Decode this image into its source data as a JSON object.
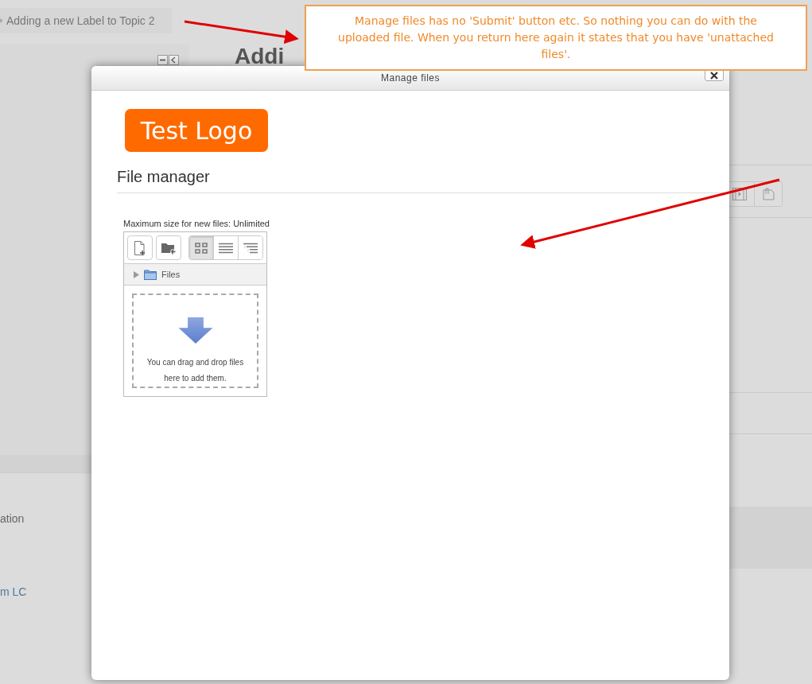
{
  "breadcrumb": "Adding a new Label to Topic 2",
  "page_heading": "Addi",
  "sidebar_fragments": [
    "ation",
    "m LC"
  ],
  "dialog": {
    "title": "Manage files",
    "logo": "Test Logo",
    "section_heading": "File manager",
    "file_manager": {
      "max_size_note": "Maximum size for new files: Unlimited",
      "views": [
        {
          "kind": "icons",
          "selected": true
        },
        {
          "kind": "list",
          "selected": false
        },
        {
          "kind": "tree",
          "selected": false
        }
      ],
      "path": "Files",
      "drop_hint": "You can drag and drop files here to add them."
    }
  },
  "annotation": "Manage files has no 'Submit' button etc.  So nothing you can do with the uploaded file.  When you return here again it states that you have 'unattached files'."
}
